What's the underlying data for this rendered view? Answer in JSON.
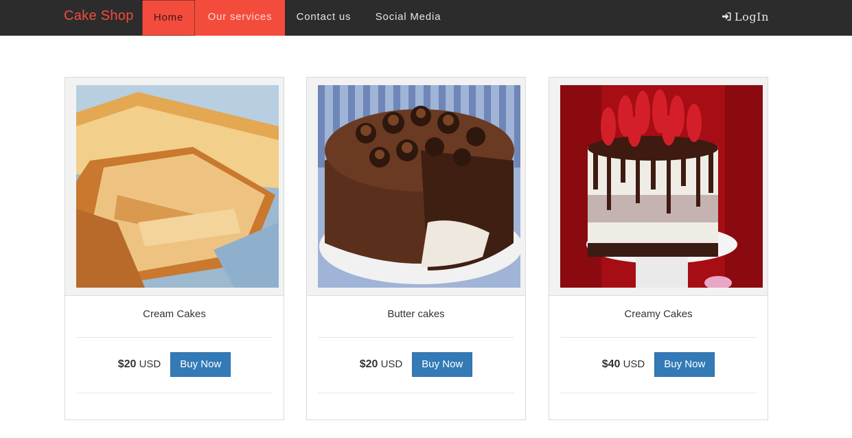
{
  "navbar": {
    "brand": "Cake Shop",
    "items": [
      {
        "label": "Home"
      },
      {
        "label": "Our services"
      },
      {
        "label": "Contact us"
      },
      {
        "label": "Social Media"
      }
    ],
    "login_label": "LogIn",
    "login_icon": "sign-in-icon"
  },
  "colors": {
    "navbar_bg": "#2c2c2c",
    "accent": "#f44c3c",
    "button": "#337ab7"
  },
  "products": [
    {
      "name": "Cream Cakes",
      "price": "$20",
      "currency": "USD",
      "button": "Buy Now",
      "image": "cream-cake-photo"
    },
    {
      "name": "Butter cakes",
      "price": "$20",
      "currency": "USD",
      "button": "Buy Now",
      "image": "chocolate-cake-photo"
    },
    {
      "name": "Creamy Cakes",
      "price": "$40",
      "currency": "USD",
      "button": "Buy Now",
      "image": "strawberry-drip-cake-photo"
    }
  ]
}
